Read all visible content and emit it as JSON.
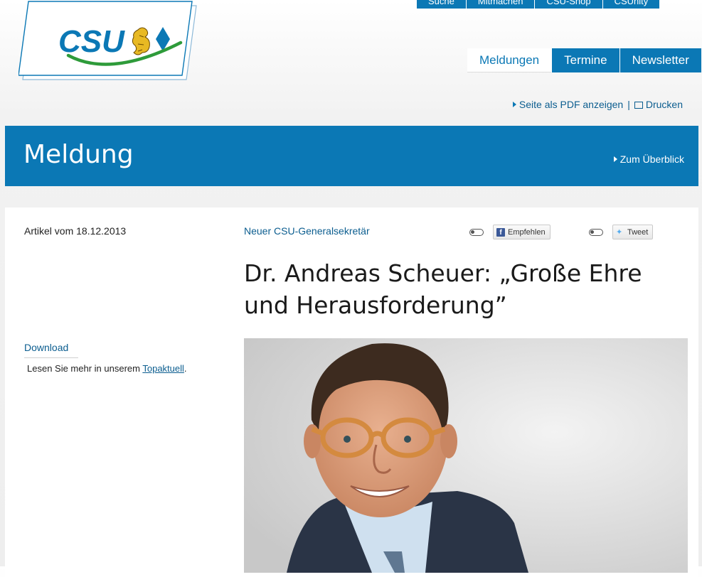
{
  "topnav": {
    "items": [
      "Suche",
      "Mitmachen",
      "CSU-Shop",
      "CSUnity"
    ]
  },
  "logo": {
    "text": "CSU"
  },
  "tabs": [
    {
      "label": "Meldungen",
      "active": true
    },
    {
      "label": "Termine",
      "active": false
    },
    {
      "label": "Newsletter",
      "active": false
    }
  ],
  "utility": {
    "pdf_label": "Seite als PDF anzeigen",
    "separator": "|",
    "print_label": "Drucken"
  },
  "banner": {
    "title": "Meldung",
    "back_label": "Zum Überblick"
  },
  "article": {
    "date": "Artikel vom 18.12.2013",
    "kicker": "Neuer CSU-Generalsekretär",
    "headline": "Dr. Andreas Scheuer: „Große Ehre und Herausforderung”"
  },
  "social": {
    "facebook_label": "Empfehlen",
    "twitter_label": "Tweet"
  },
  "download": {
    "title": "Download",
    "text_before": "Lesen Sie mehr in unserem ",
    "link": "Topaktuell",
    "text_after": "."
  },
  "colors": {
    "brand_blue": "#0b78b5",
    "logo_green": "#2e9b3a",
    "link_blue": "#0b5d8f"
  }
}
